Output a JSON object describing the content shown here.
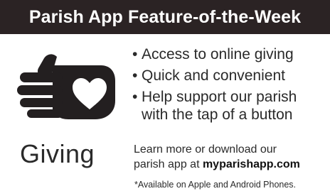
{
  "header": {
    "title": "Parish App Feature-of-the-Week"
  },
  "feature": {
    "icon": "giving-hand-heart-icon",
    "label": "Giving"
  },
  "bullets": [
    {
      "glyph": "•",
      "text": "Access to online giving"
    },
    {
      "glyph": "•",
      "text": "Quick and convenient"
    },
    {
      "glyph": "•",
      "text": "Help support our parish\nwith the tap of a button"
    }
  ],
  "learn_more": {
    "text_line1": "Learn more or download our",
    "text_line2": "parish app at ",
    "url": "myparishapp.com"
  },
  "footnote": "*Available on Apple and Android Phones.",
  "colors": {
    "header_bg": "#2b2324",
    "icon": "#231f20"
  }
}
